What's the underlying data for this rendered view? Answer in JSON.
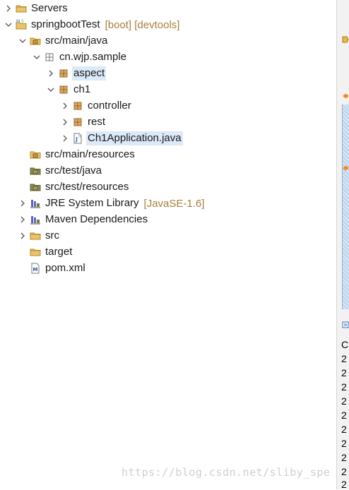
{
  "tree": {
    "servers": "Servers",
    "project": {
      "label": "springbootTest",
      "decoration": "[boot] [devtools]"
    },
    "src_main_java": "src/main/java",
    "package": "cn.wjp.sample",
    "aspect": "aspect",
    "ch1": "ch1",
    "controller": "controller",
    "rest": "rest",
    "ch1app": "Ch1Application.java",
    "src_main_resources": "src/main/resources",
    "src_test_java": "src/test/java",
    "src_test_resources": "src/test/resources",
    "jre": {
      "label": "JRE System Library",
      "decoration": "[JavaSE-1.6]"
    },
    "maven": "Maven Dependencies",
    "src": "src",
    "target": "target",
    "pom": "pom.xml"
  },
  "right_panel": {
    "header_letter": "C",
    "column_digits": [
      "2",
      "2",
      "2",
      "2",
      "2",
      "2",
      "2",
      "2",
      "2",
      "2"
    ]
  },
  "watermark": "https://blog.csdn.net/sliby_spe"
}
